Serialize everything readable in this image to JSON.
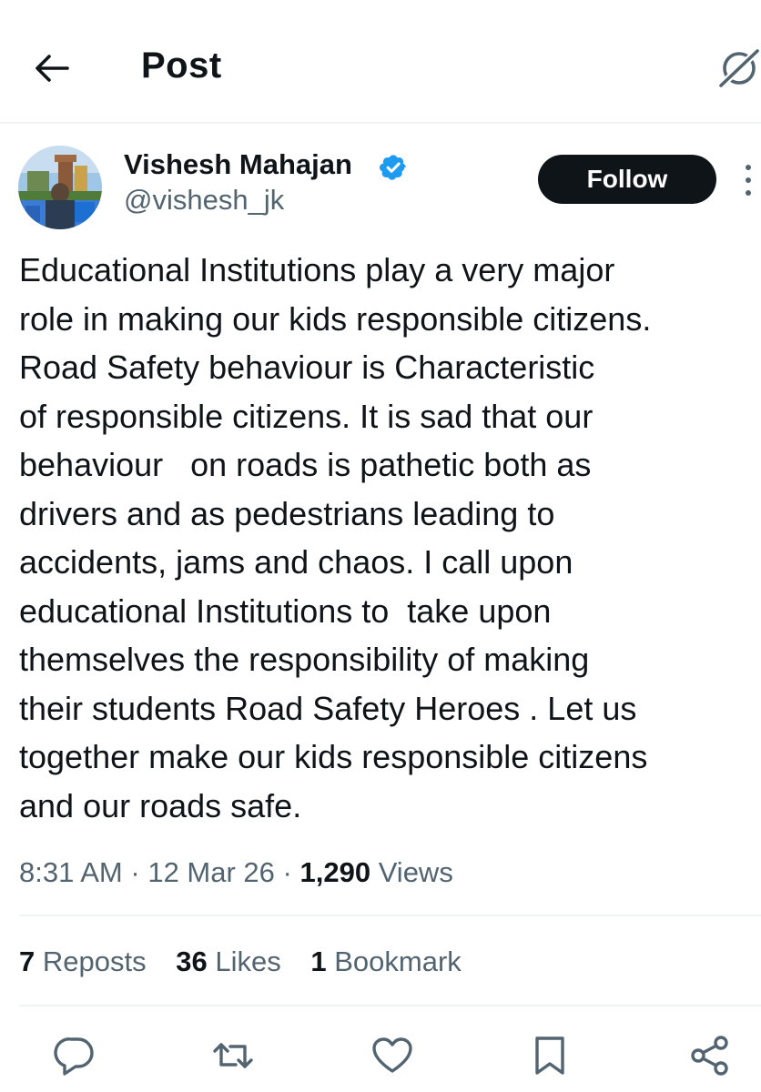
{
  "header": {
    "title": "Post"
  },
  "author": {
    "name": "Vishesh Mahajan",
    "handle": "@vishesh_jk",
    "follow_label": "Follow"
  },
  "post": {
    "lines": [
      "Educational Institutions play a very major",
      "role in making our kids responsible citizens.",
      "Road Safety behaviour is Characteristic",
      "of responsible citizens. It is sad that our",
      "behaviour   on roads is pathetic both as",
      "drivers and as pedestrians leading to",
      "accidents, jams and chaos. I call upon",
      "educational Institutions to  take upon",
      "themselves the responsibility of making",
      "their students Road Safety Heroes . Let us",
      "together make our kids responsible citizens",
      "and our roads safe."
    ]
  },
  "meta": {
    "time": "8:31 AM",
    "sep": "·",
    "date": "12 Mar 26",
    "views_count": "1,290",
    "views_label": "Views"
  },
  "stats": {
    "reposts_count": "7",
    "reposts_label": "Reposts",
    "likes_count": "36",
    "likes_label": "Likes",
    "bookmarks_count": "1",
    "bookmarks_label": "Bookmark"
  },
  "actions": [
    "reply-icon",
    "repost-icon",
    "like-icon",
    "bookmark-icon",
    "share-icon"
  ],
  "colors": {
    "text": "#0f1419",
    "secondary": "#536471",
    "verified": "#1d9bf0",
    "divider": "#eff3f4"
  }
}
